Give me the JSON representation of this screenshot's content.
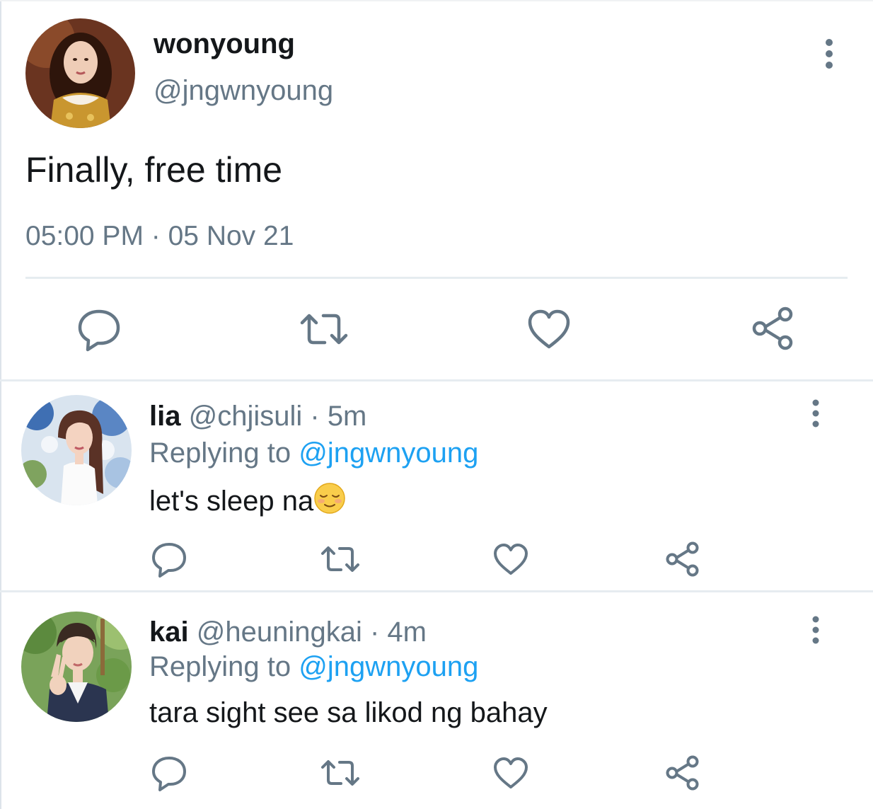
{
  "main_tweet": {
    "name": "wonyoung",
    "handle": "@jngwnyoung",
    "text": "Finally, free time",
    "time": "05:00 PM",
    "separator": " · ",
    "date": "05 Nov 21",
    "actions": [
      "comment-icon",
      "retweet-icon",
      "heart-icon",
      "share-icon"
    ]
  },
  "replies": [
    {
      "name": "lia",
      "handle": "@chjisuli",
      "separator": " · ",
      "time": "5m",
      "replying_prefix": "Replying to ",
      "replying_to": "@jngwnyoung",
      "text": "let's sleep na",
      "emoji": "relieved-face-emoji"
    },
    {
      "name": "kai",
      "handle": "@heuningkai",
      "separator": " · ",
      "time": "4m",
      "replying_prefix": "Replying to ",
      "replying_to": "@jngwnyoung",
      "text": "tara sight see sa likod ng bahay"
    }
  ],
  "colors": {
    "text_primary": "#14171a",
    "text_secondary": "#657786",
    "link": "#1da1f2",
    "icon": "#657786",
    "divider": "#e6ecf0"
  }
}
